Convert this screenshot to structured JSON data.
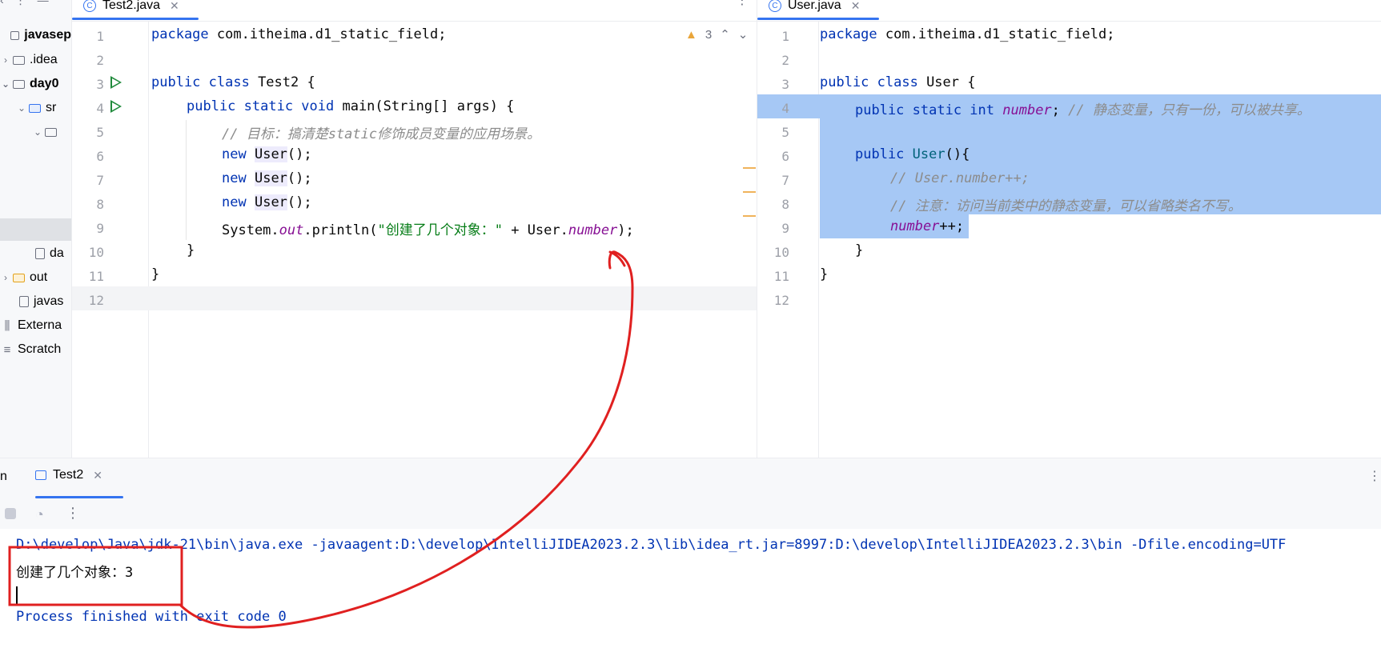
{
  "project_tree": {
    "items": [
      {
        "label": "javasep",
        "type": "project",
        "bold": true
      },
      {
        "label": ".idea",
        "type": "folder"
      },
      {
        "label": "day0",
        "type": "module",
        "bold": true
      },
      {
        "label": "sr",
        "type": "src-folder"
      },
      {
        "label": "",
        "type": "package"
      },
      {
        "label": "da",
        "type": "file"
      },
      {
        "label": "out",
        "type": "out-folder"
      },
      {
        "label": "javas",
        "type": "file"
      },
      {
        "label": "Externa",
        "type": "libraries"
      },
      {
        "label": "Scratch",
        "type": "scratches"
      }
    ]
  },
  "editor_left": {
    "tab_label": "Test2.java",
    "warnings_count": "3",
    "lines": [
      "1",
      "2",
      "3",
      "4",
      "5",
      "6",
      "7",
      "8",
      "9",
      "10",
      "11",
      "12"
    ],
    "code": {
      "l1_kw": "package",
      "l1_rest": " com.itheima.d1_static_field;",
      "l3_kw": "public class",
      "l3_rest": " Test2 {",
      "l4_kw": "public static void",
      "l4_rest": " main(String[] args) {",
      "l5_comment": "// 目标：搞清楚static修饰成员变量的应用场景。",
      "l6_kw": "new",
      "l6_cls": "User",
      "l6_rest": "();",
      "l7_kw": "new",
      "l7_cls": "User",
      "l7_rest": "();",
      "l8_kw": "new",
      "l8_cls": "User",
      "l8_rest": "();",
      "l9_a": "System.",
      "l9_out": "out",
      "l9_b": ".println(",
      "l9_str": "\"创建了几个对象：\"",
      "l9_c": " + User.",
      "l9_fld": "number",
      "l9_d": ");",
      "l10": "}",
      "l11": "}"
    }
  },
  "editor_right": {
    "tab_label": "User.java",
    "lines": [
      "1",
      "2",
      "3",
      "4",
      "5",
      "6",
      "7",
      "8",
      "9",
      "10",
      "11",
      "12"
    ],
    "code": {
      "l1_kw": "package",
      "l1_rest": " com.itheima.d1_static_field;",
      "l3_kw": "public class",
      "l3_rest": " User {",
      "l4_kw": "public static int",
      "l4_fld": "number",
      "l4_semi": ";",
      "l4_comment": " // 静态变量，只有一份，可以被共享。",
      "l6_kw": "public",
      "l6_ctor": "User",
      "l6_rest": "(){",
      "l7_comment": "// User.number++;",
      "l8_comment": "// 注意：访问当前类中的静态变量，可以省略类名不写。",
      "l9_fld": "number",
      "l9_rest": "++;",
      "l10": "}",
      "l11": "}"
    }
  },
  "run_panel": {
    "label": "n",
    "tab_label": "Test2",
    "console": {
      "command": "D:\\develop\\Java\\jdk-21\\bin\\java.exe -javaagent:D:\\develop\\IntelliJIDEA2023.2.3\\lib\\idea_rt.jar=8997:D:\\develop\\IntelliJIDEA2023.2.3\\bin -Dfile.encoding=UTF",
      "output": "创建了几个对象：3",
      "exit": "Process finished with exit code 0"
    }
  },
  "colors": {
    "keyword": "#0033b3",
    "field": "#871094",
    "comment": "#8c8c8c",
    "string": "#067d17",
    "selection": "#a6c8f5",
    "accent": "#3574f0",
    "annotation": "#e02020"
  }
}
